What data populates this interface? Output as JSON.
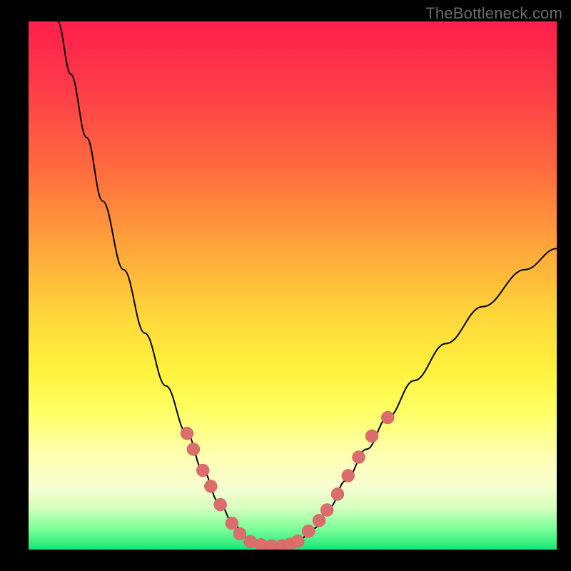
{
  "watermark": "TheBottleneck.com",
  "chart_data": {
    "type": "line",
    "title": "",
    "xlabel": "",
    "ylabel": "",
    "xlim": [
      0,
      100
    ],
    "ylim": [
      0,
      100
    ],
    "curve": [
      {
        "x": 5.5,
        "y": 100
      },
      {
        "x": 8,
        "y": 90
      },
      {
        "x": 11,
        "y": 78
      },
      {
        "x": 14,
        "y": 66
      },
      {
        "x": 18,
        "y": 53
      },
      {
        "x": 22,
        "y": 41
      },
      {
        "x": 26,
        "y": 31
      },
      {
        "x": 30,
        "y": 22
      },
      {
        "x": 33,
        "y": 15
      },
      {
        "x": 36,
        "y": 9
      },
      {
        "x": 39,
        "y": 4.5
      },
      {
        "x": 42,
        "y": 1.8
      },
      {
        "x": 45,
        "y": 0.7
      },
      {
        "x": 48,
        "y": 0.7
      },
      {
        "x": 51,
        "y": 1.6
      },
      {
        "x": 54,
        "y": 4
      },
      {
        "x": 57,
        "y": 8
      },
      {
        "x": 60,
        "y": 13
      },
      {
        "x": 64,
        "y": 19
      },
      {
        "x": 68,
        "y": 25
      },
      {
        "x": 73,
        "y": 32
      },
      {
        "x": 79,
        "y": 39
      },
      {
        "x": 86,
        "y": 46
      },
      {
        "x": 94,
        "y": 53
      },
      {
        "x": 100,
        "y": 57
      }
    ],
    "left_dots": [
      {
        "x": 30.0,
        "y": 22.0
      },
      {
        "x": 31.2,
        "y": 19.0
      },
      {
        "x": 33.0,
        "y": 15.0
      },
      {
        "x": 34.5,
        "y": 12.0
      },
      {
        "x": 36.3,
        "y": 8.5
      },
      {
        "x": 38.5,
        "y": 5.0
      },
      {
        "x": 40.0,
        "y": 3.0
      },
      {
        "x": 42.0,
        "y": 1.5
      },
      {
        "x": 44.0,
        "y": 0.9
      },
      {
        "x": 46.0,
        "y": 0.7
      },
      {
        "x": 48.0,
        "y": 0.7
      }
    ],
    "right_dots": [
      {
        "x": 49.5,
        "y": 1.0
      },
      {
        "x": 51.0,
        "y": 1.6
      },
      {
        "x": 53.0,
        "y": 3.5
      },
      {
        "x": 55.0,
        "y": 5.5
      },
      {
        "x": 56.5,
        "y": 7.5
      },
      {
        "x": 58.5,
        "y": 10.5
      },
      {
        "x": 60.5,
        "y": 14.0
      },
      {
        "x": 62.5,
        "y": 17.5
      },
      {
        "x": 65.0,
        "y": 21.5
      },
      {
        "x": 68.0,
        "y": 25.0
      }
    ],
    "colors": {
      "top": "#ff1f4b",
      "mid": "#ffe63a",
      "bottom": "#18e679",
      "dot": "#db6d6d"
    }
  }
}
